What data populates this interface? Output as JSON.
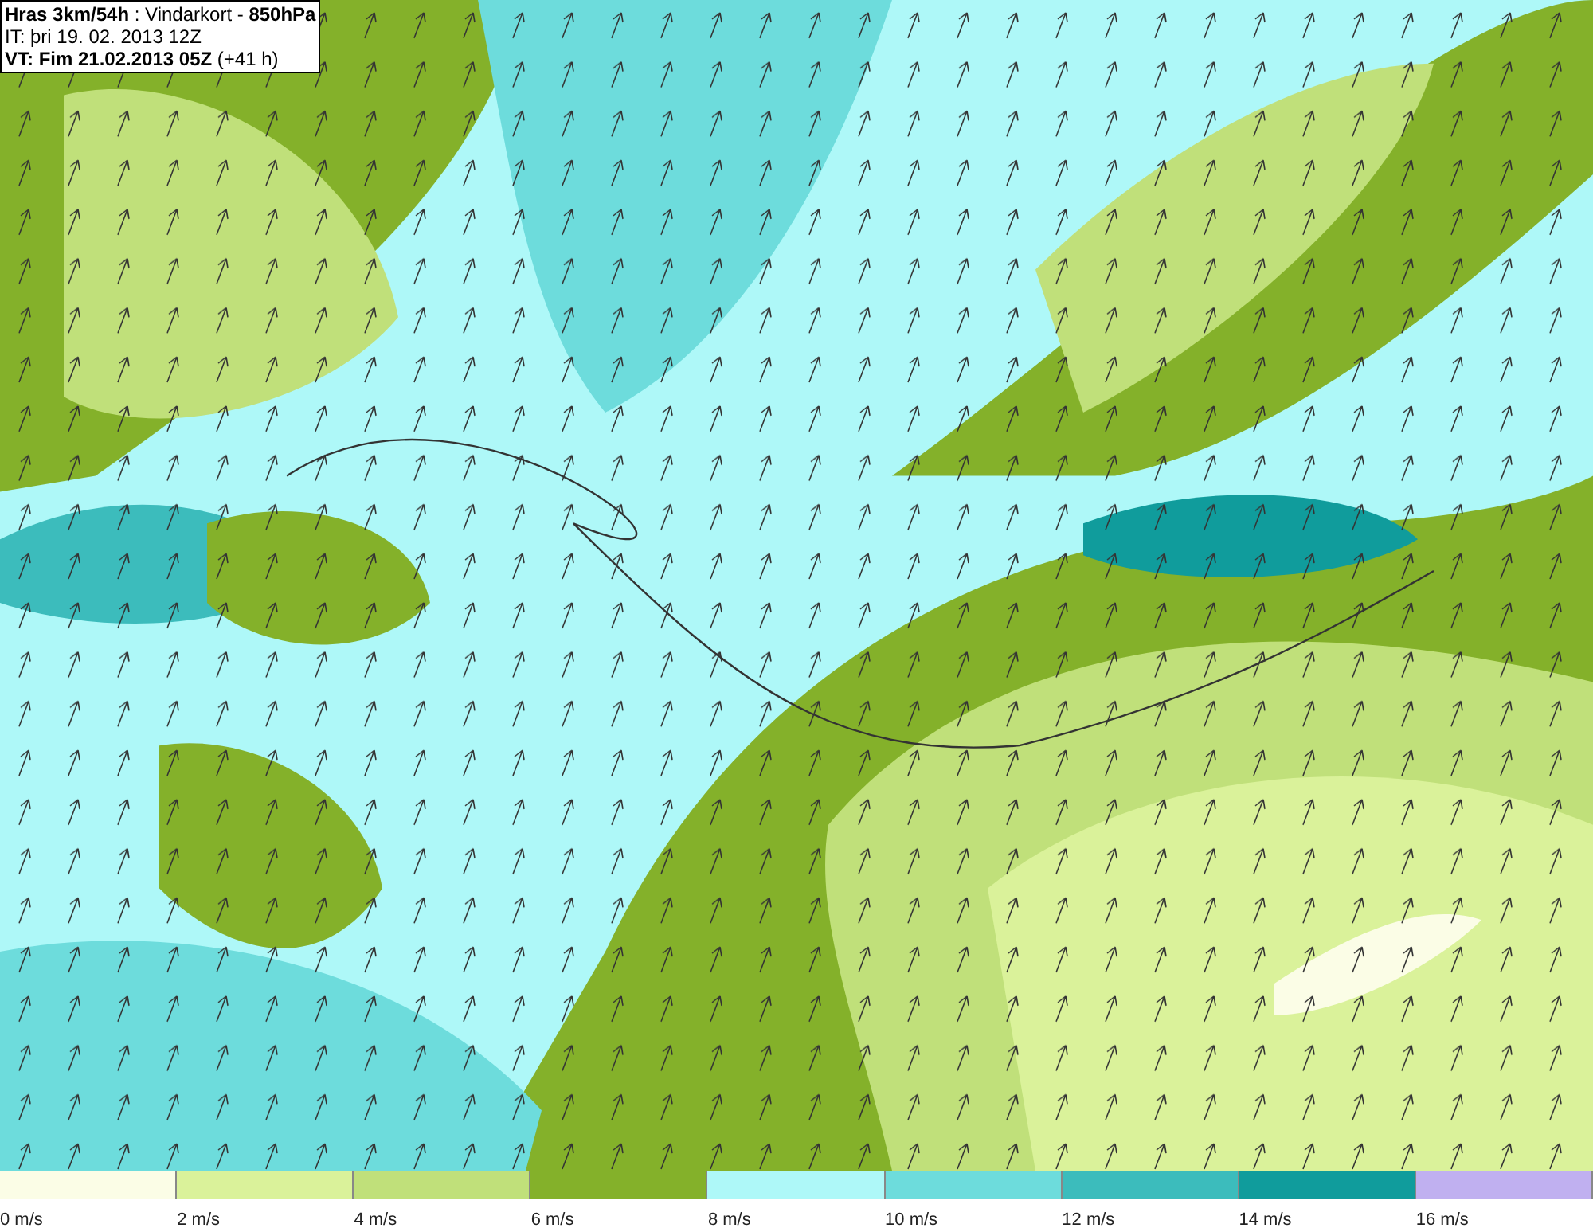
{
  "header": {
    "lines": [
      "**Hras 3km/54h** : Vindarkort - **850hPa**",
      "IT: þri 19. 02. 2013 12Z",
      "**VT: Fim 21.02.2013 05Z** (+41 h)"
    ]
  },
  "legend": [
    {
      "label": "0 m/s",
      "color": "#fbfde6"
    },
    {
      "label": "2 m/s",
      "color": "#daf29a"
    },
    {
      "label": "4 m/s",
      "color": "#c0e07a"
    },
    {
      "label": "6 m/s",
      "color": "#84b12a"
    },
    {
      "label": "8 m/s",
      "color": "#aef8f8"
    },
    {
      "label": "10 m/s",
      "color": "#6ddcdc"
    },
    {
      "label": "12 m/s",
      "color": "#3cbcbc"
    },
    {
      "label": "14 m/s",
      "color": "#109c9c"
    },
    {
      "label": "16 m/s",
      "color": "#c0b0f0"
    }
  ]
}
